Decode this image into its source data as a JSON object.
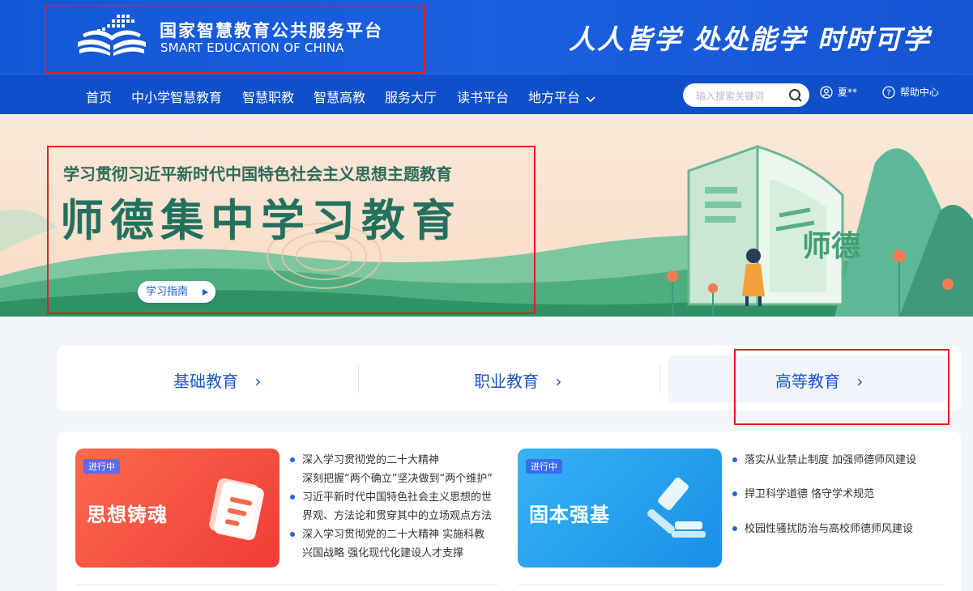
{
  "header": {
    "logo_cn": "国家智慧教育公共服务平台",
    "logo_en": "SMART EDUCATION OF CHINA",
    "slogan": "人人皆学 处处能学 时时可学"
  },
  "nav": {
    "items": [
      "首页",
      "中小学智慧教育",
      "智慧职教",
      "智慧高教",
      "服务大厅",
      "读书平台",
      "地方平台"
    ],
    "search_placeholder": "输入搜索关键词",
    "user_name": "夏**",
    "help_label": "帮助中心"
  },
  "banner": {
    "subtitle": "学习贯彻习近平新时代中国特色社会主义思想主题教育",
    "title": "师德集中学习教育",
    "guide_button": "学习指南",
    "art_text": "师德"
  },
  "education": {
    "items": [
      "基础教育",
      "职业教育",
      "高等教育"
    ],
    "arrow": "›"
  },
  "cards": [
    {
      "badge": "进行中",
      "title": "思想铸魂",
      "bullets": [
        [
          "深入学习贯彻党的二十大精神",
          "深刻把握“两个确立”坚决做到“两个维护”"
        ],
        [
          "习近平新时代中国特色社会主义思想的世",
          "界观、方法论和贯穿其中的立场观点方法"
        ],
        [
          "深入学习贯彻党的二十大精神 实施科教",
          "兴国战略 强化现代化建设人才支撑"
        ]
      ]
    },
    {
      "badge": "进行中",
      "title": "固本强基",
      "bullets": [
        [
          "落实从业禁止制度 加强师德师风建设"
        ],
        [
          "捍卫科学道德 恪守学术规范"
        ],
        [
          "校园性骚扰防治与高校师德师风建设"
        ]
      ]
    }
  ],
  "colors": {
    "header_blue": "#1a5fe0",
    "nav_blue": "#0f4fc9",
    "accent_green": "#23705f",
    "card1": "#f0453a",
    "card2": "#2aa3ee",
    "highlight_red": "#e0201c"
  }
}
